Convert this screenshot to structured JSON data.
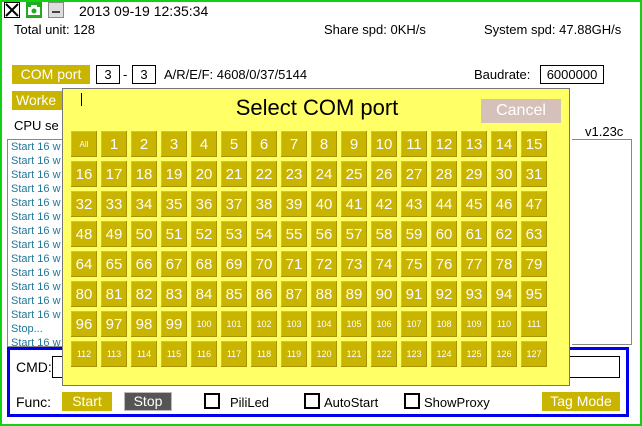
{
  "header": {
    "datetime": "2013 09-19 12:35:34",
    "total_unit": "Total unit: 128",
    "share_spd": "Share spd: 0KH/s",
    "system_spd": "System spd: 47.88GH/s"
  },
  "com": {
    "button": "COM port",
    "from": "3",
    "sep": "-",
    "to": "3",
    "stats": "A/R/E/F: 4608/0/37/5144",
    "baudrate_label": "Baudrate:",
    "baudrate_value": "6000000"
  },
  "worker_button": "Worke",
  "cpu_label": "CPU se",
  "version": "v1.23c",
  "log_lines": [
    "Start 16 w",
    "Start 16 w",
    "Start 16 w",
    "Start 16 w",
    "Start 16 w",
    "Start 16 w",
    "Start 16 w",
    "Start 16 w",
    "Start 16 w",
    "Start 16 w",
    "Start 16 w",
    "Start 16 w",
    "Start 16 w",
    "Stop...",
    "Start 16 w"
  ],
  "dialog": {
    "title": "Select COM port",
    "cancel": "Cancel",
    "all_label": "All",
    "ports": [
      "1",
      "2",
      "3",
      "4",
      "5",
      "6",
      "7",
      "8",
      "9",
      "10",
      "11",
      "12",
      "13",
      "14",
      "15",
      "16",
      "17",
      "18",
      "19",
      "20",
      "21",
      "22",
      "23",
      "24",
      "25",
      "26",
      "27",
      "28",
      "29",
      "30",
      "31",
      "32",
      "33",
      "34",
      "35",
      "36",
      "37",
      "38",
      "39",
      "40",
      "41",
      "42",
      "43",
      "44",
      "45",
      "46",
      "47",
      "48",
      "49",
      "50",
      "51",
      "52",
      "53",
      "54",
      "55",
      "56",
      "57",
      "58",
      "59",
      "60",
      "61",
      "62",
      "63",
      "64",
      "65",
      "66",
      "67",
      "68",
      "69",
      "70",
      "71",
      "72",
      "73",
      "74",
      "75",
      "76",
      "77",
      "78",
      "79",
      "80",
      "81",
      "82",
      "83",
      "84",
      "85",
      "86",
      "87",
      "88",
      "89",
      "90",
      "91",
      "92",
      "93",
      "94",
      "95",
      "96",
      "97",
      "98",
      "99",
      "100",
      "101",
      "102",
      "103",
      "104",
      "105",
      "106",
      "107",
      "108",
      "109",
      "110",
      "111",
      "112",
      "113",
      "114",
      "115",
      "116",
      "117",
      "118",
      "119",
      "120",
      "121",
      "122",
      "123",
      "124",
      "125",
      "126",
      "127"
    ]
  },
  "bottom": {
    "cmd_label": "CMD:",
    "func_label": "Func:",
    "start": "Start",
    "stop": "Stop",
    "pililed": "PiliLed",
    "autostart": "AutoStart",
    "showproxy": "ShowProxy",
    "tagmode": "Tag Mode"
  },
  "icons": {
    "close": "close-icon",
    "camera": "camera-icon",
    "minimize": "minimize-icon"
  },
  "colors": {
    "accent": "#c9b400",
    "dialog_bg": "#ffff66",
    "frame": "#12d012",
    "cmd_border": "#0000ee",
    "log_text": "#22779a"
  }
}
